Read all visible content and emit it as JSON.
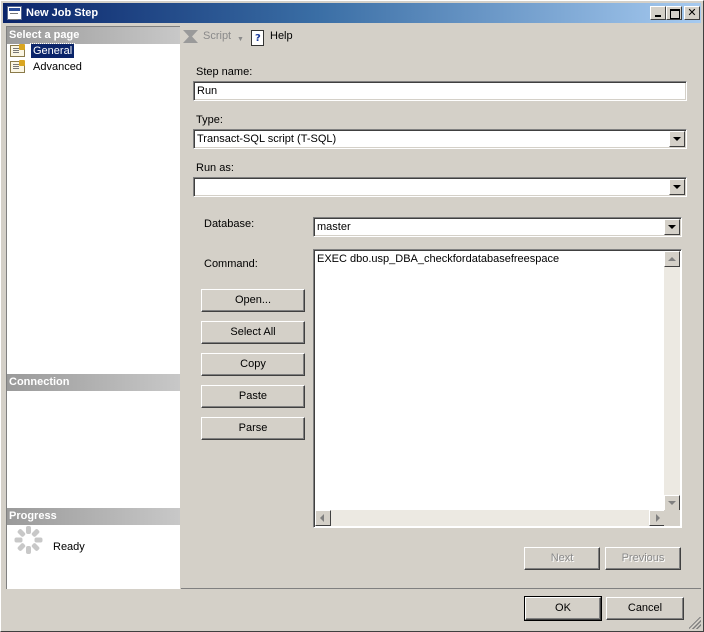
{
  "window": {
    "title": "New Job Step"
  },
  "left_panel": {
    "select_page_header": "Select a page",
    "pages": [
      {
        "label": "General",
        "selected": true
      },
      {
        "label": "Advanced",
        "selected": false
      }
    ],
    "connection_header": "Connection",
    "progress_header": "Progress",
    "progress_status": "Ready"
  },
  "toolbar": {
    "script_label": "Script",
    "help_label": "Help"
  },
  "form": {
    "step_name_label": "Step name:",
    "step_name_value": "Run",
    "type_label": "Type:",
    "type_value": "Transact-SQL script (T-SQL)",
    "run_as_label": "Run as:",
    "run_as_value": "",
    "database_label": "Database:",
    "database_value": "master",
    "command_label": "Command:",
    "command_value": "EXEC dbo.usp_DBA_checkfordatabasefreespace"
  },
  "command_buttons": {
    "open": "Open...",
    "select_all": "Select All",
    "copy": "Copy",
    "paste": "Paste",
    "parse": "Parse"
  },
  "nav_buttons": {
    "next": "Next",
    "previous": "Previous"
  },
  "dialog_buttons": {
    "ok": "OK",
    "cancel": "Cancel"
  }
}
